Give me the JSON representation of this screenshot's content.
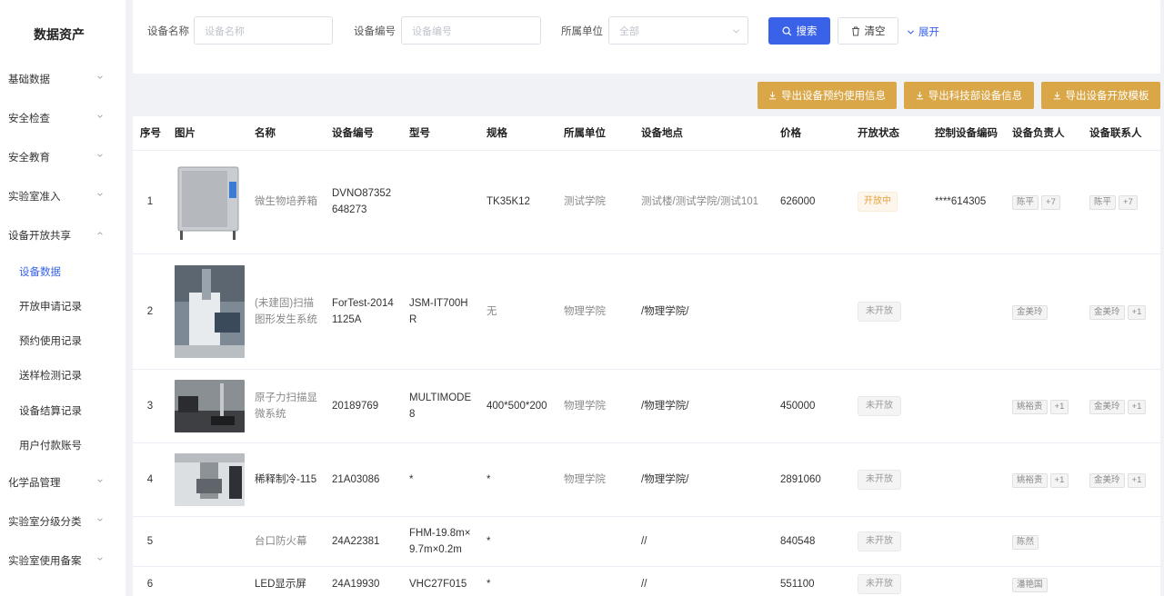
{
  "sidebar": {
    "title": "数据资产",
    "menu": [
      {
        "label": "基础数据"
      },
      {
        "label": "安全检查"
      },
      {
        "label": "安全教育"
      },
      {
        "label": "实验室准入"
      },
      {
        "label": "设备开放共享"
      },
      {
        "label": "化学品管理"
      },
      {
        "label": "实验室分级分类"
      },
      {
        "label": "实验室使用备案"
      }
    ],
    "submenu": [
      {
        "label": "设备数据"
      },
      {
        "label": "开放申请记录"
      },
      {
        "label": "预约使用记录"
      },
      {
        "label": "送样检测记录"
      },
      {
        "label": "设备结算记录"
      },
      {
        "label": "用户付款账号"
      }
    ]
  },
  "search": {
    "name_label": "设备名称",
    "name_placeholder": "设备名称",
    "code_label": "设备编号",
    "code_placeholder": "设备编号",
    "unit_label": "所属单位",
    "unit_value": "全部",
    "search_button": "搜索",
    "clear_button": "清空",
    "expand_link": "展开"
  },
  "exports": [
    {
      "label": "导出设备预约使用信息"
    },
    {
      "label": "导出科技部设备信息"
    },
    {
      "label": "导出设备开放模板"
    }
  ],
  "table": {
    "headers": [
      "序号",
      "图片",
      "名称",
      "设备编号",
      "型号",
      "规格",
      "所属单位",
      "设备地点",
      "价格",
      "开放状态",
      "控制设备编码",
      "设备负责人",
      "设备联系人"
    ],
    "rows": [
      {
        "index": "1",
        "name": "微生物培养箱",
        "code": "DVNO87352648273",
        "model": "",
        "spec": "TK35K12",
        "unit": "测试学院",
        "location": "测试楼/测试学院/测试101",
        "price": "626000",
        "status": "开放中",
        "ctrl": "****614305",
        "owner": "陈平",
        "owner_more": "+7",
        "contact": "陈平",
        "contact_more": "+7"
      },
      {
        "index": "2",
        "name": "(未建固)扫描图形发生系统",
        "code": "ForTest-20141125A",
        "model": "JSM-IT700HR",
        "spec": "无",
        "unit": "物理学院",
        "location": "/物理学院/",
        "price": "",
        "status": "未开放",
        "ctrl": "",
        "owner": "金美玲",
        "owner_more": "",
        "contact": "金美玲",
        "contact_more": "+1"
      },
      {
        "index": "3",
        "name": "原子力扫描显微系统",
        "code": "20189769",
        "model": "MULTIMODE8",
        "spec": "400*500*200",
        "unit": "物理学院",
        "location": "/物理学院/",
        "price": "450000",
        "status": "未开放",
        "ctrl": "",
        "owner": "姚裕贵",
        "owner_more": "+1",
        "contact": "金美玲",
        "contact_more": "+1"
      },
      {
        "index": "4",
        "name": "稀释制冷-115",
        "code": "21A03086",
        "model": "*",
        "spec": "*",
        "unit": "物理学院",
        "location": "/物理学院/",
        "price": "2891060",
        "status": "未开放",
        "ctrl": "",
        "owner": "姚裕贵",
        "owner_more": "+1",
        "contact": "金美玲",
        "contact_more": "+1"
      },
      {
        "index": "5",
        "name": "台口防火幕",
        "code": "24A22381",
        "model": "FHM-19.8m×9.7m×0.2m",
        "spec": "*",
        "unit": "",
        "location": "//",
        "price": "840548",
        "status": "未开放",
        "ctrl": "",
        "owner": "陈然",
        "owner_more": "",
        "contact": "",
        "contact_more": ""
      },
      {
        "index": "6",
        "name": "LED显示屏",
        "code": "24A19930",
        "model": "VHC27F015",
        "spec": "*",
        "unit": "",
        "location": "//",
        "price": "551100",
        "status": "未开放",
        "ctrl": "",
        "owner": "潘艳国",
        "owner_more": "",
        "contact": "",
        "contact_more": ""
      }
    ]
  },
  "colors": {
    "primary": "#3a62e8",
    "export": "#d9a748",
    "open_tag": "#e6a23c"
  }
}
